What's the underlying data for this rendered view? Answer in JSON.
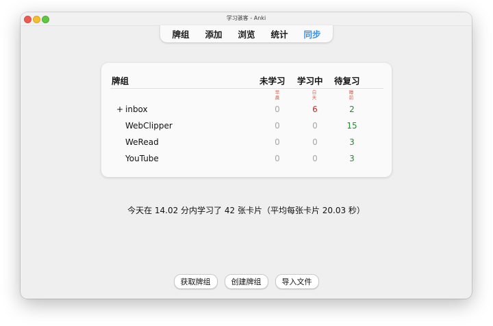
{
  "window": {
    "title": "学习骇客 - Anki"
  },
  "toolbar": {
    "items": [
      {
        "label": "牌组",
        "active": false
      },
      {
        "label": "添加",
        "active": false
      },
      {
        "label": "浏览",
        "active": false
      },
      {
        "label": "统计",
        "active": false
      },
      {
        "label": "同步",
        "active": true
      }
    ]
  },
  "deck_table": {
    "headers": {
      "deck": "牌组",
      "new": "未学习",
      "learning": "学习中",
      "due": "待复习"
    },
    "subheaders": {
      "new": "早晨",
      "learning": "白天",
      "due": "睡前"
    },
    "rows": [
      {
        "expander": "+",
        "name": "inbox",
        "new": "0",
        "learning": "6",
        "due": "2"
      },
      {
        "expander": "",
        "name": "WebClipper",
        "new": "0",
        "learning": "0",
        "due": "15"
      },
      {
        "expander": "",
        "name": "WeRead",
        "new": "0",
        "learning": "0",
        "due": "3"
      },
      {
        "expander": "",
        "name": "YouTube",
        "new": "0",
        "learning": "0",
        "due": "3"
      }
    ]
  },
  "summary": "今天在 14.02 分内学习了 42 张卡片（平均每张卡片 20.03 秒）",
  "bottom_buttons": {
    "get_shared": "获取牌组",
    "create_deck": "创建牌组",
    "import_file": "导入文件"
  },
  "colors": {
    "accent": "#3d8ee8",
    "learning_count": "#c62828",
    "due_count": "#1f8f2c",
    "zero_count": "#a6a6a6",
    "subheader": "#d0604e"
  }
}
